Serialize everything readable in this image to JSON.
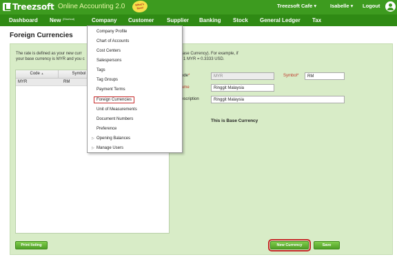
{
  "header": {
    "logo_text": "Treezsoft",
    "product": "Online Accounting 2.0",
    "badge": "What's New!",
    "company": "Treezsoft Cafe",
    "user": "Isabelle",
    "logout": "Logout"
  },
  "nav": {
    "dashboard": "Dashboard",
    "new": "New",
    "new_sup": "(Shortcut)",
    "company": "Company",
    "customer": "Customer",
    "supplier": "Supplier",
    "banking": "Banking",
    "stock": "Stock",
    "general_ledger": "General Ledger",
    "tax": "Tax"
  },
  "page": {
    "title": "Foreign Currencies"
  },
  "help": {
    "line1": "The rate is defined as your new curr",
    "line2": "your base currency is MYR and you c",
    "right1": "Base Currency). For example, if",
    "right2": "n 1 MYR = 0.3333 USD."
  },
  "grid": {
    "columns": [
      "Code",
      "Symbol"
    ],
    "sort_indicator": "▲",
    "rows": [
      {
        "code": "MYR",
        "symbol": "RM"
      }
    ]
  },
  "form": {
    "code_label": "ode",
    "code_value": "MYR",
    "symbol_label": "Symbol",
    "symbol_value": "RM",
    "name_label": "ame",
    "name_value": "Ringgit Malaysia",
    "description_label": "escription",
    "description_value": "Ringgit Malaysia",
    "required_mark": "*",
    "base_note": "This is Base Currency"
  },
  "buttons": {
    "print": "Print listing",
    "new_currency": "New Currency",
    "save": "Save"
  },
  "company_menu": {
    "items": [
      "Company Profile",
      "Chart of Accounts",
      "Cost Centers",
      "Salespersons",
      "Tags",
      "Tag Groups",
      "Payment Terms",
      "Foreign Currencies",
      "Unit of Measurements",
      "Document Numbers",
      "Preference",
      "Opening Balances",
      "Manage Users"
    ],
    "submenu_marker": "▷"
  },
  "colors": {
    "brand_green": "#3d9b1f",
    "nav_green": "#2f8a14",
    "panel_green": "#d8ecc7",
    "highlight_red": "#c62828"
  }
}
